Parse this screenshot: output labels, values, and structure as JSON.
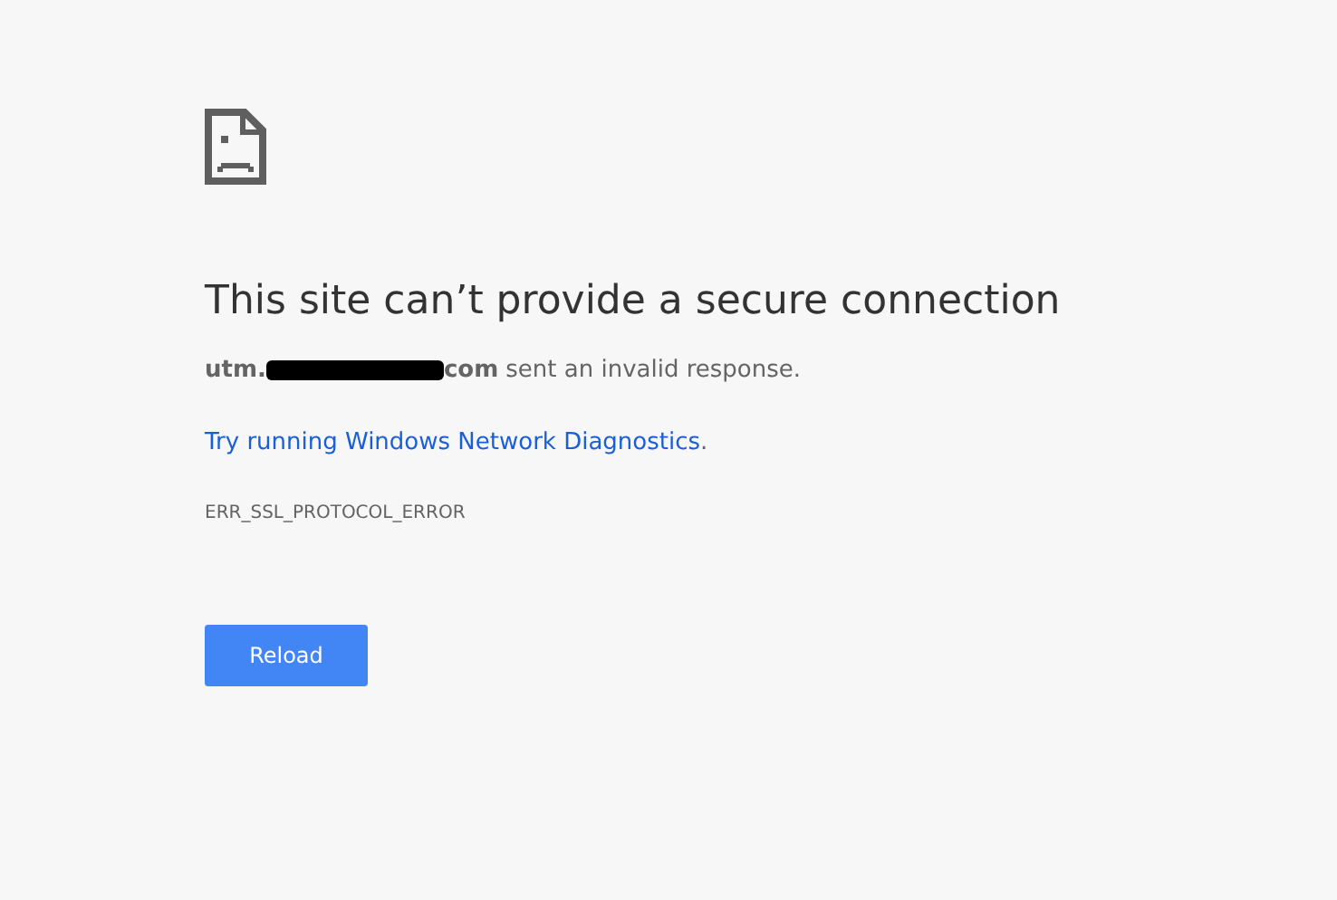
{
  "heading": "This site can’t provide a secure connection",
  "host_start": "utm.",
  "host_end": "com",
  "host_redacted": true,
  "message": "sent an invalid response.",
  "suggestion_link": "Try running Windows Network Diagnostics",
  "suggestion_end": ".",
  "error_code": "ERR_SSL_PROTOCOL_ERROR",
  "buttons": [
    "Reload"
  ]
}
